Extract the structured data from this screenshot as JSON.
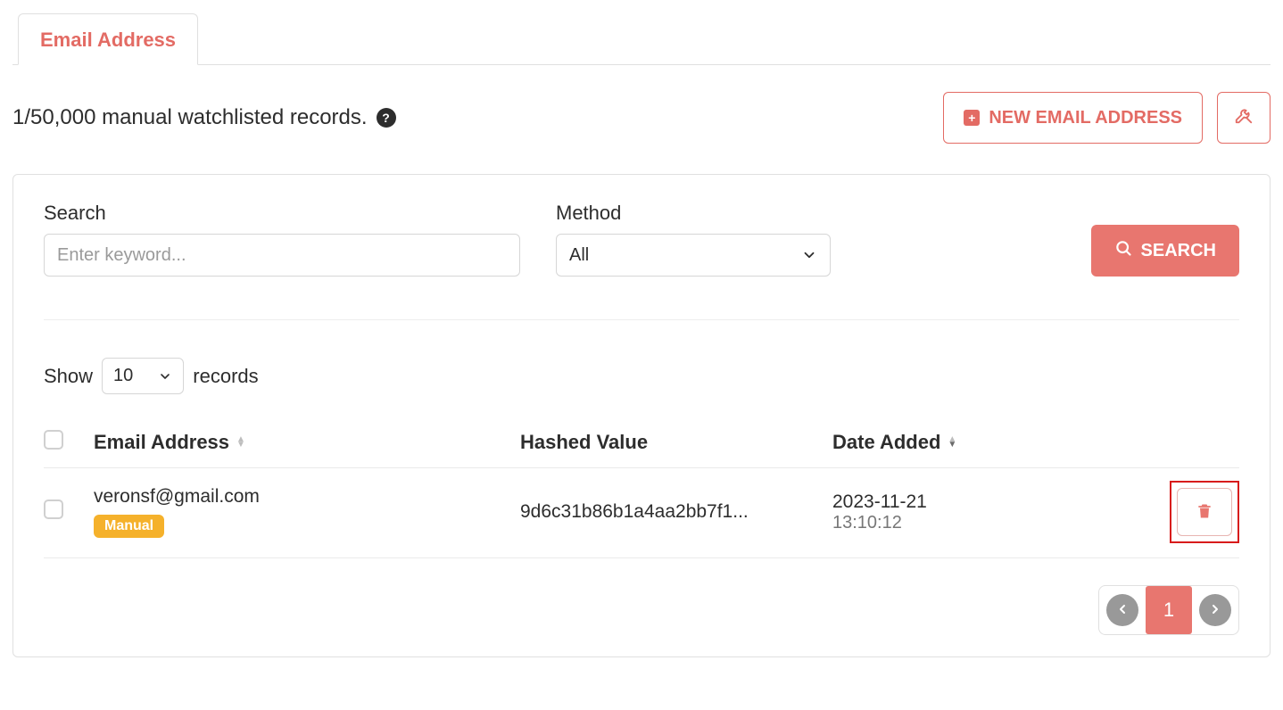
{
  "tabs": {
    "email_address": "Email Address"
  },
  "header": {
    "records_text": "1/50,000 manual watchlisted records.",
    "new_button": "NEW EMAIL ADDRESS"
  },
  "filters": {
    "search_label": "Search",
    "search_placeholder": "Enter keyword...",
    "method_label": "Method",
    "method_value": "All",
    "search_button": "SEARCH"
  },
  "listing": {
    "show_prefix": "Show",
    "show_value": "10",
    "show_suffix": "records",
    "columns": {
      "email": "Email Address",
      "hashed": "Hashed Value",
      "date": "Date Added"
    },
    "rows": [
      {
        "email": "veronsf@gmail.com",
        "tag": "Manual",
        "hash": "9d6c31b86b1a4aa2bb7f1...",
        "date": "2023-11-21",
        "time": "13:10:12"
      }
    ]
  },
  "pagination": {
    "current": "1"
  }
}
